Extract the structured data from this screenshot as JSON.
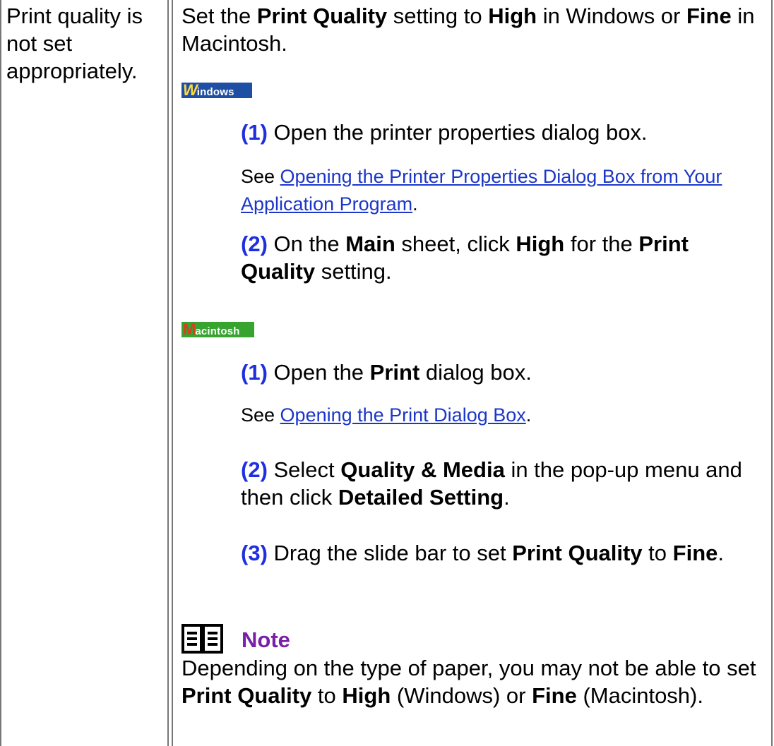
{
  "cause": "Print quality is not set appropriately.",
  "intro": {
    "t1": "Set the ",
    "b1": "Print Quality",
    "t2": " setting to ",
    "b2": "High",
    "t3": " in Windows or ",
    "b3": "Fine",
    "t4": " in Macintosh."
  },
  "windows": {
    "badge_big": "W",
    "badge_rest": "indows",
    "step1": {
      "num": "(1)",
      "text": " Open the printer properties dialog box."
    },
    "see": {
      "prefix": "See ",
      "link": "Opening the Printer Properties Dialog Box from Your Application Program",
      "suffix": "."
    },
    "step2": {
      "num": "(2)",
      "t1": " On the ",
      "b1": "Main",
      "t2": " sheet, click ",
      "b2": "High",
      "t3": " for the ",
      "b3": "Print Quality",
      "t4": " setting."
    }
  },
  "macintosh": {
    "badge_big": "M",
    "badge_rest": "acintosh",
    "step1": {
      "num": "(1)",
      "t1": " Open the ",
      "b1": "Print",
      "t2": " dialog box."
    },
    "see": {
      "prefix": "See ",
      "link": "Opening the Print Dialog Box",
      "suffix": "."
    },
    "step2": {
      "num": "(2)",
      "t1": " Select ",
      "b1": "Quality & Media",
      "t2": " in the pop-up menu and then click ",
      "b2": "Detailed Setting",
      "t3": "."
    },
    "step3": {
      "num": "(3)",
      "t1": " Drag the slide bar to set ",
      "b1": "Print Quality",
      "t2": " to ",
      "b2": "Fine",
      "t3": "."
    }
  },
  "note": {
    "icon": "book-icon",
    "title": "Note",
    "t1": "Depending on the type of paper, you may not be able to set ",
    "b1": "Print Quality",
    "t2": " to ",
    "b2": "High",
    "t3": " (Windows) or ",
    "b3": "Fine",
    "t4": " (Macintosh)."
  },
  "colors": {
    "step_number": "#1f2fe0",
    "note_title": "#7a1fa6",
    "link": "#1c37c8",
    "windows_badge": "#1f4fa5",
    "macintosh_badge": "#36a42f"
  }
}
